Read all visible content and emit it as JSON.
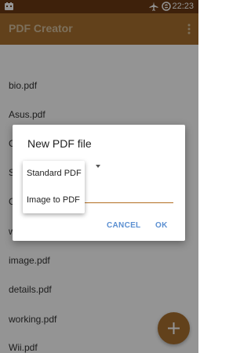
{
  "status_bar": {
    "time": "22:23",
    "icons": [
      "app-notification-icon",
      "airplane-mode-icon",
      "sync-icon"
    ]
  },
  "app_bar": {
    "title": "PDF Creator",
    "menu_icon": "overflow-menu-icon"
  },
  "files": [
    {
      "name": "bio.pdf"
    },
    {
      "name": "Asus.pdf"
    },
    {
      "name": "C"
    },
    {
      "name": "S"
    },
    {
      "name": "C"
    },
    {
      "name": "w"
    },
    {
      "name": "image.pdf"
    },
    {
      "name": "details.pdf"
    },
    {
      "name": "working.pdf"
    },
    {
      "name": "Wii.pdf"
    }
  ],
  "dialog": {
    "title": "New PDF file",
    "cancel_label": "CANCEL",
    "ok_label": "OK"
  },
  "dropdown": {
    "options": [
      "Standard PDF",
      "Image to PDF"
    ]
  },
  "fab": {
    "icon": "plus-icon"
  },
  "colors": {
    "status_bar": "#6b3a13",
    "app_bar": "#a9712f",
    "accent_button": "#5b8fd1",
    "input_underline": "#b36e21"
  }
}
